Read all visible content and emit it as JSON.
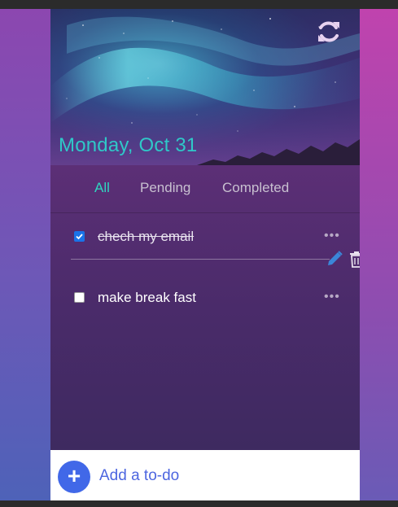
{
  "header": {
    "date": "Monday, Oct 31"
  },
  "tabs": [
    {
      "label": "All"
    },
    {
      "label": "Pending"
    },
    {
      "label": "Completed"
    }
  ],
  "todos": [
    {
      "text": "chech my email",
      "completed": true,
      "menu": "•••"
    },
    {
      "text": "make break fast",
      "completed": false,
      "menu": "•••"
    }
  ],
  "add": {
    "placeholder": "Add a to-do",
    "button": "+"
  },
  "icons": {
    "refresh": "refresh-icon",
    "edit": "pencil-icon",
    "delete": "trash-icon",
    "add": "plus-icon"
  },
  "colors": {
    "accent": "#2fd6c0",
    "date": "#2fc8c8",
    "add_button": "#4168e8",
    "edit_icon": "#3b86d8"
  }
}
